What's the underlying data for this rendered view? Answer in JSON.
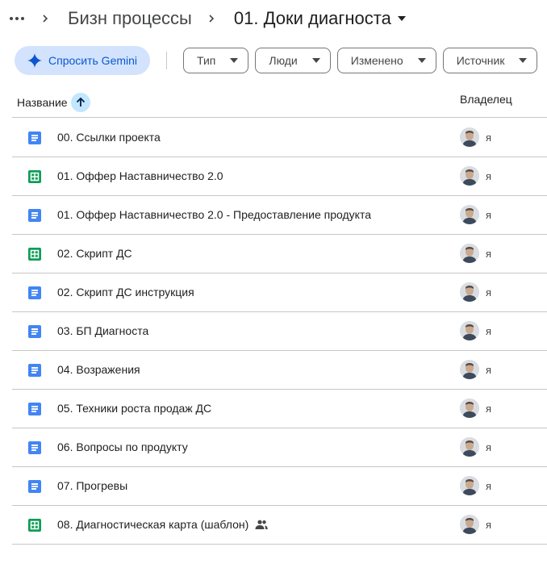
{
  "breadcrumb": {
    "more_icon": "more-horiz-icon",
    "items": [
      "Бизн процессы",
      "01. Доки диагноста"
    ]
  },
  "toolbar": {
    "gemini_label": "Спросить Gemini",
    "filters": [
      "Тип",
      "Люди",
      "Изменено",
      "Источник"
    ]
  },
  "columns": {
    "name": "Название",
    "owner": "Владелец"
  },
  "files": [
    {
      "name": "00. Ссылки проекта",
      "type": "doc",
      "owner": "я",
      "shared": false
    },
    {
      "name": "01. Оффер Наставничество 2.0",
      "type": "sheet",
      "owner": "я",
      "shared": false
    },
    {
      "name": "01. Оффер Наставничество 2.0 - Предоставление продукта",
      "type": "doc",
      "owner": "я",
      "shared": false
    },
    {
      "name": "02. Скрипт ДС",
      "type": "sheet",
      "owner": "я",
      "shared": false
    },
    {
      "name": "02. Скрипт ДС инструкция",
      "type": "doc",
      "owner": "я",
      "shared": false
    },
    {
      "name": "03. БП Диагноста",
      "type": "doc",
      "owner": "я",
      "shared": false
    },
    {
      "name": "04. Возражения",
      "type": "doc",
      "owner": "я",
      "shared": false
    },
    {
      "name": "05. Техники роста продаж ДС",
      "type": "doc",
      "owner": "я",
      "shared": false
    },
    {
      "name": "06. Вопросы по продукту",
      "type": "doc",
      "owner": "я",
      "shared": false
    },
    {
      "name": "07. Прогревы",
      "type": "doc",
      "owner": "я",
      "shared": false
    },
    {
      "name": "08. Диагностическая карта (шаблон)",
      "type": "sheet",
      "owner": "я",
      "shared": true
    }
  ],
  "colors": {
    "doc": "#4285f4",
    "sheet": "#0f9d58",
    "gemini_bg": "#d3e3fd",
    "accent": "#0b57d0"
  }
}
